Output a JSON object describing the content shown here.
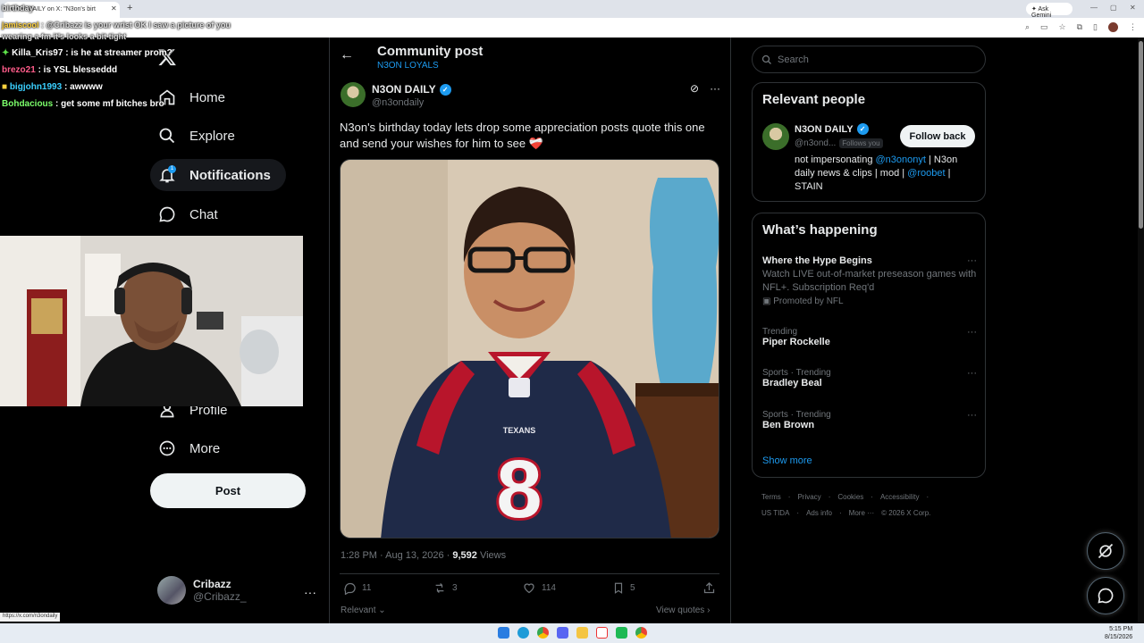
{
  "browser": {
    "tab_title": "N3ON DAILY on X: \"N3on's birt",
    "tab_close": "✕",
    "new_tab": "+",
    "gemini_label": "Ask Gemini",
    "status_url": "https://x.com/n3ondaily"
  },
  "chat": {
    "top_overlay": "birthday",
    "messages": [
      {
        "user": "jamiscool",
        "text": ": @Cribazz is your wrist OK I saw a picture of you",
        "color": "#ffd23f"
      },
      {
        "user": "",
        "text": "wearing a fm it's looks a bit tight",
        "color": "#ffffff"
      },
      {
        "user": "Killa_Kris97",
        "text": ": is he at streamer prom?",
        "color": "#5fe34a"
      },
      {
        "user": "brezo21",
        "text": ": is YSL blesseddd",
        "color": "#ff5c8a"
      },
      {
        "user": "bigjohn1993",
        "text": ": awwww",
        "color": "#3ad0ff"
      },
      {
        "user": "Bohdacious",
        "text": ": get some mf bitches bro",
        "color": "#7cff6b"
      }
    ]
  },
  "nav": {
    "home": "Home",
    "explore": "Explore",
    "notifications": "Notifications",
    "notifications_badge": "1",
    "chat": "Chat",
    "profile": "Profile",
    "more": "More",
    "post_button": "Post"
  },
  "account": {
    "name": "Cribazz",
    "handle": "@Cribazz_",
    "more": "···"
  },
  "post": {
    "header_title": "Community post",
    "community": "N3ON LOYALS",
    "author_name": "N3ON DAILY",
    "author_handle": "@n3ondaily",
    "text": "N3on's birthday today lets drop some appreciation posts quote this one and send your wishes for him to see ❤️‍🩹",
    "time": "1:28 PM · Aug 13, 2026 · ",
    "views_count": "9,592",
    "views_label": " Views",
    "replies": "11",
    "reposts": "3",
    "likes": "114",
    "bookmarks": "5",
    "relevant": "Relevant",
    "view_quotes": "View quotes",
    "jersey_number": "8",
    "jersey_text": "TEXANS"
  },
  "sidebar": {
    "search_placeholder": "Search",
    "relevant_title": "Relevant people",
    "person_name": "N3ON DAILY",
    "person_handle": "@n3ond...",
    "follows_you": "Follows you",
    "follow_back": "Follow back",
    "bio_pre": "not impersonating ",
    "bio_link1": "@n3ononyt",
    "bio_mid": " | N3on daily news & clips | mod | ",
    "bio_link2": "@roobet",
    "bio_post": " | STAIN",
    "happening_title": "What’s happening",
    "trends": [
      {
        "meta": "",
        "name": "Where the Hype Begins",
        "desc": "Watch LIVE out-of-market preseason games with NFL+. Subscription Req'd",
        "promo": "Promoted by NFL"
      },
      {
        "meta": "Trending",
        "name": "Piper Rockelle",
        "desc": "",
        "promo": ""
      },
      {
        "meta": "Sports · Trending",
        "name": "Bradley Beal",
        "desc": "",
        "promo": ""
      },
      {
        "meta": "Sports · Trending",
        "name": "Ben Brown",
        "desc": "",
        "promo": ""
      }
    ],
    "show_more": "Show more",
    "footer_row1": [
      "Terms",
      "Privacy",
      "Cookies",
      "Accessibility"
    ],
    "footer_row2": [
      "US TIDA",
      "Ads info",
      "More ···",
      "© 2026 X Corp."
    ]
  },
  "taskbar": {
    "time": "5:15 PM",
    "date": "8/15/2026"
  }
}
